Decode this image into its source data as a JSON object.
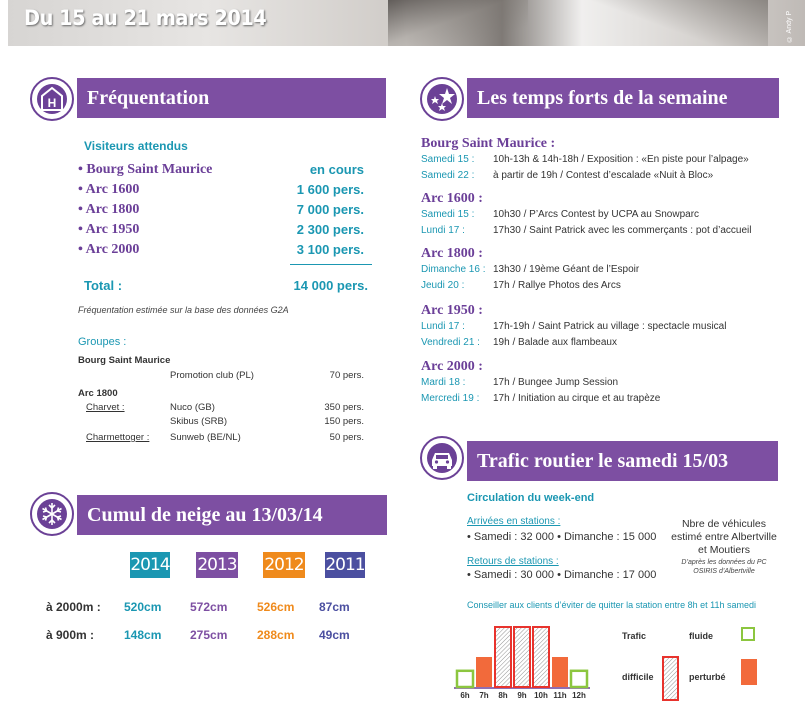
{
  "header": {
    "title": "Du 15 au 21 mars 2014",
    "credit": "© Andy P"
  },
  "frequentation": {
    "title": "Fréquentation",
    "subtitle": "Visiteurs attendus",
    "rows": [
      {
        "name": "• Bourg Saint Maurice",
        "value": "en cours"
      },
      {
        "name": "• Arc 1600",
        "value": "1 600 pers."
      },
      {
        "name": "• Arc 1800",
        "value": "7 000 pers."
      },
      {
        "name": "• Arc 1950",
        "value": "2 300 pers."
      },
      {
        "name": "• Arc 2000",
        "value": "3 100 pers."
      }
    ],
    "total_label": "Total :",
    "total_value": "14 000 pers.",
    "note": "Fréquentation estimée sur la base des données G2A",
    "groups_title": "Groupes :",
    "groups": {
      "bsm_title": "Bourg Saint Maurice",
      "bsm_name": "Promotion club (PL)",
      "bsm_value": "70 pers.",
      "arc1800_title": "Arc 1800",
      "charvet": "Charvet :",
      "nuco": "Nuco (GB)",
      "nuco_value": "350 pers.",
      "skibus": "Skibus (SRB)",
      "skibus_value": "150 pers.",
      "charmettoger": "Charmettoger :",
      "sunweb": "Sunweb (BE/NL)",
      "sunweb_value": "50 pers."
    }
  },
  "snow": {
    "title": "Cumul de neige au 13/03/14",
    "years": [
      {
        "label": "2014",
        "color": "#1b97b2"
      },
      {
        "label": "2013",
        "color": "#7d4fa2"
      },
      {
        "label": "2012",
        "color": "#ef8a1c"
      },
      {
        "label": "2011",
        "color": "#4b4fa0"
      }
    ],
    "rows": [
      {
        "label": "à 2000m :",
        "values": [
          "520cm",
          "572cm",
          "526cm",
          "87cm"
        ]
      },
      {
        "label": "à 900m :",
        "values": [
          "148cm",
          "275cm",
          "288cm",
          "49cm"
        ]
      }
    ]
  },
  "events": {
    "title": "Les temps forts de la semaine",
    "sections": [
      {
        "place": "Bourg Saint Maurice :",
        "items": [
          {
            "date": "Samedi 15 :",
            "text": "10h-13h & 14h-18h / Exposition : «En piste pour l’alpage»"
          },
          {
            "date": "Samedi 22 :",
            "text": "à partir de 19h / Contest d’escalade «Nuit à Bloc»"
          }
        ]
      },
      {
        "place": "Arc 1600 :",
        "items": [
          {
            "date": "Samedi 15 :",
            "text": "10h30 / P’Arcs Contest by UCPA au Snowparc"
          },
          {
            "date": "Lundi 17 :",
            "text": "17h30 / Saint Patrick avec les commerçants : pot d’accueil"
          }
        ]
      },
      {
        "place": "Arc 1800 :",
        "items": [
          {
            "date": "Dimanche 16 :",
            "text": "13h30 / 19ème Géant de l’Espoir"
          },
          {
            "date": "Jeudi 20 :",
            "text": "17h / Rallye Photos des Arcs"
          }
        ]
      },
      {
        "place": "Arc 1950 :",
        "items": [
          {
            "date": "Lundi 17 :",
            "text": "17h-19h / Saint Patrick au village : spectacle musical"
          },
          {
            "date": "Vendredi 21 :",
            "text": "19h / Balade aux flambeaux"
          }
        ]
      },
      {
        "place": "Arc 2000 :",
        "items": [
          {
            "date": "Mardi 18 :",
            "text": "17h / Bungee Jump Session"
          },
          {
            "date": "Mercredi 19 :",
            "text": "17h / Initiation au cirque et au trapèze"
          }
        ]
      }
    ]
  },
  "traffic": {
    "title": "Trafic routier le samedi 15/03",
    "subtitle": "Circulation du week-end",
    "arrivals_label": "Arrivées en stations :",
    "arrivals_text": "• Samedi : 32 000 • Dimanche : 15 000",
    "returns_label": "Retours de stations :",
    "returns_text": "• Samedi : 30 000 • Dimanche : 17 000",
    "vehicles_note": "Nbre de véhicules estimé entre Albertville et Moutiers",
    "source_note": "D’après les données du PC OSIRIS d’Albertville",
    "advice": "Conseiller aux clients d’éviter de quitter la station entre 8h et 11h samedi",
    "hours": [
      "6h",
      "7h",
      "8h",
      "9h",
      "10h",
      "11h",
      "12h"
    ],
    "levels": [
      "fluide",
      "perturbé",
      "difficile",
      "difficile",
      "difficile",
      "perturbé",
      "fluide"
    ],
    "legend": {
      "title": "Trafic",
      "fluide": "fluide",
      "difficile": "difficile",
      "perturbe": "perturbé"
    },
    "colors": {
      "fluide": "#8cc63f",
      "perturbe": "#f26a3b",
      "difficile": "#e8332d"
    }
  }
}
